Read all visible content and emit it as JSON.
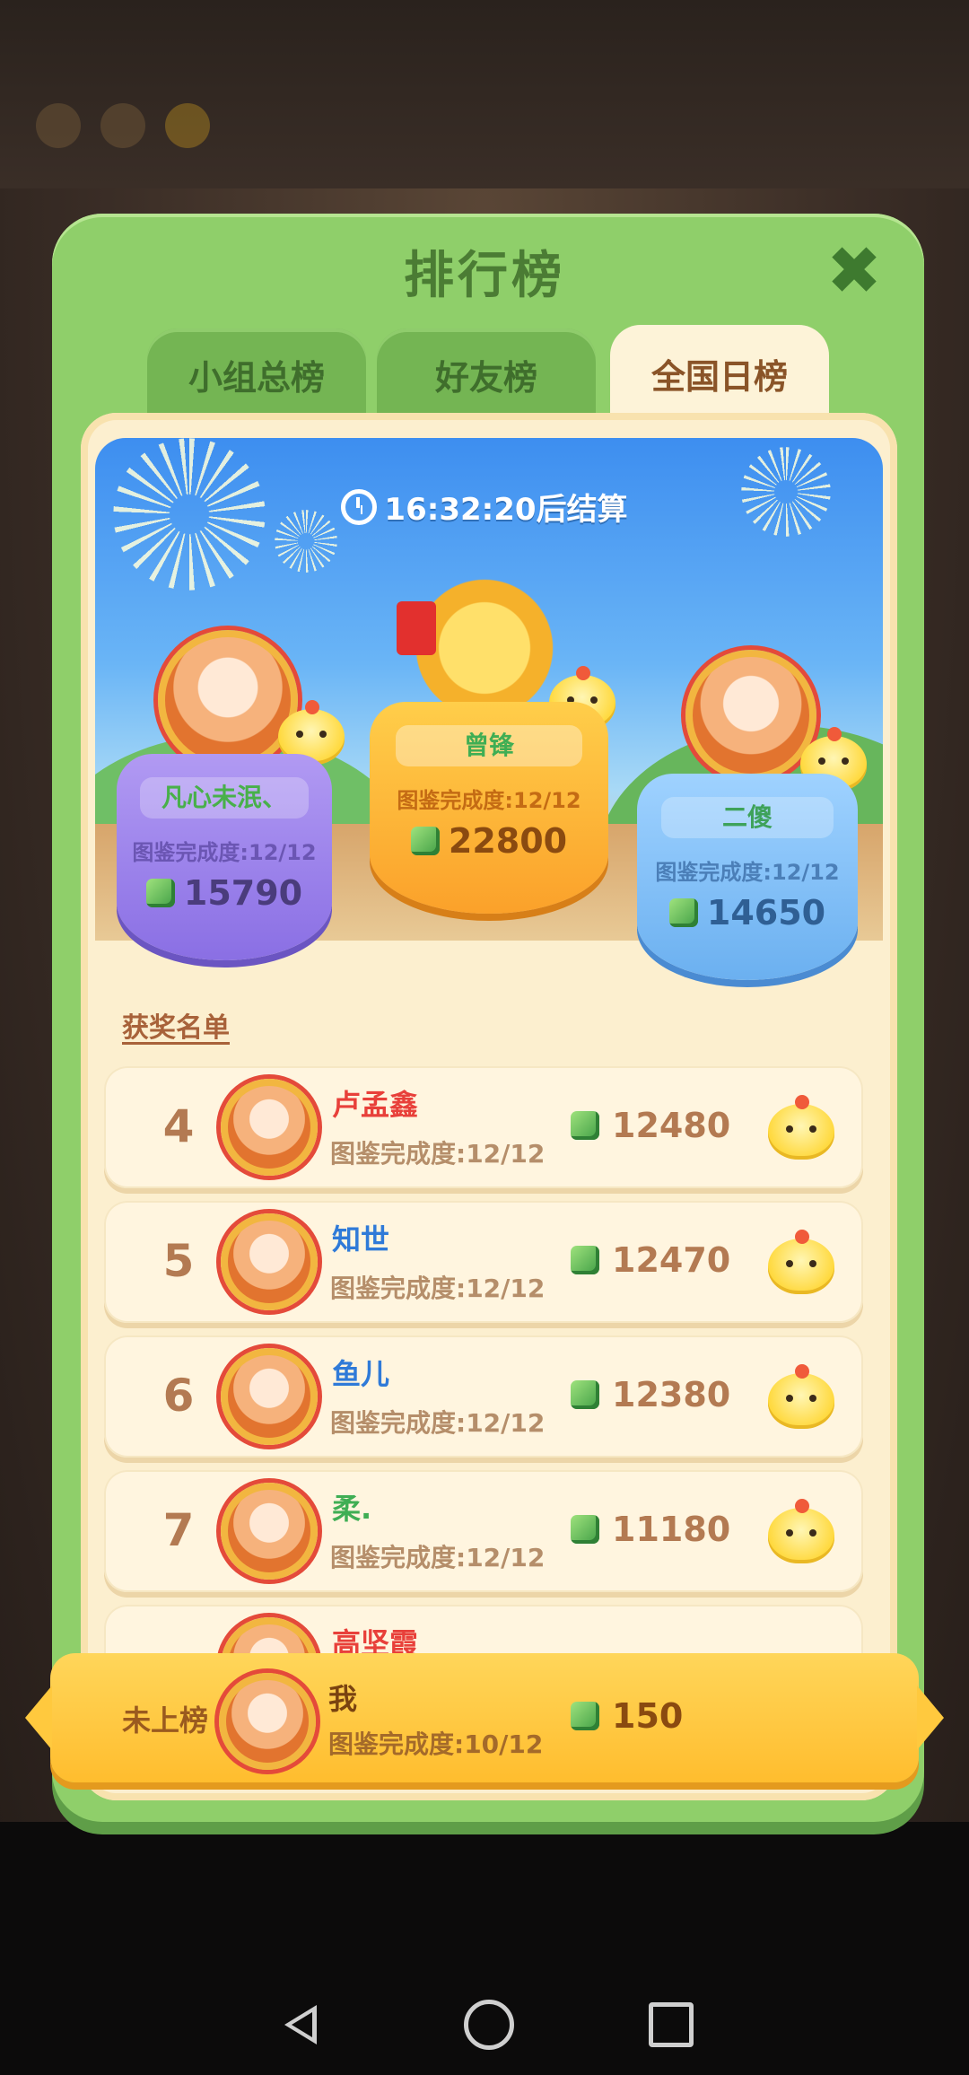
{
  "dialog": {
    "title": "排行榜",
    "tabs": [
      {
        "label": "小组总榜",
        "active": false
      },
      {
        "label": "好友榜",
        "active": false
      },
      {
        "label": "全国日榜",
        "active": true
      }
    ]
  },
  "banner": {
    "countdown": "16:32:20",
    "countdown_suffix": "后结算"
  },
  "podium": [
    {
      "rank": 1,
      "name": "曾锋",
      "completion": "图鉴完成度:12/12",
      "score": "22800"
    },
    {
      "rank": 2,
      "name": "凡心未泯、",
      "completion": "图鉴完成度:12/12",
      "score": "15790"
    },
    {
      "rank": 3,
      "name": "二傻",
      "completion": "图鉴完成度:12/12",
      "score": "14650"
    }
  ],
  "awards_label": "获奖名单",
  "rows": [
    {
      "rank": "4",
      "name": "卢孟鑫",
      "completion": "图鉴完成度:12/12",
      "score": "12480",
      "name_color": "#e8403a"
    },
    {
      "rank": "5",
      "name": "知世",
      "completion": "图鉴完成度:12/12",
      "score": "12470",
      "name_color": "#2f7ad8"
    },
    {
      "rank": "6",
      "name": "鱼儿",
      "completion": "图鉴完成度:12/12",
      "score": "12380",
      "name_color": "#2f7ad8"
    },
    {
      "rank": "7",
      "name": "柔.",
      "completion": "图鉴完成度:12/12",
      "score": "11180",
      "name_color": "#3fae54"
    },
    {
      "rank": "",
      "name": "高坚霞",
      "completion": "",
      "score": "",
      "name_color": "#e8403a"
    }
  ],
  "my_rank": {
    "status": "未上榜",
    "name": "我",
    "completion": "图鉴完成度:10/12",
    "score": "150"
  }
}
